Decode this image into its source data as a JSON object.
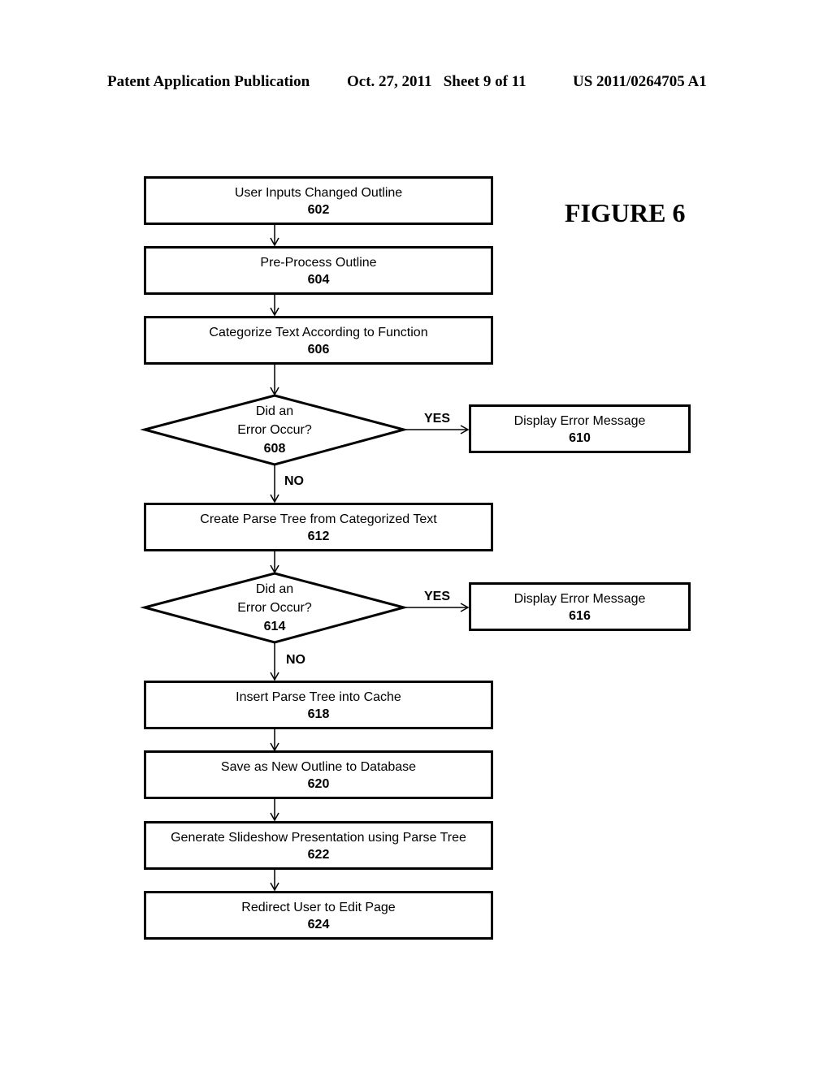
{
  "header": {
    "publication": "Patent Application Publication",
    "date_sheet": "Oct. 27, 2011   Sheet 9 of 11",
    "patent_number": "US 2011/0264705 A1"
  },
  "figure_title": "FIGURE 6",
  "nodes": {
    "n602": {
      "label": "User Inputs Changed Outline",
      "id": "602",
      "shape": "process"
    },
    "n604": {
      "label": "Pre-Process Outline",
      "id": "604",
      "shape": "process"
    },
    "n606": {
      "label": "Categorize Text According to Function",
      "id": "606",
      "shape": "process"
    },
    "n608": {
      "line1": "Did an",
      "line2": "Error Occur?",
      "id": "608",
      "shape": "decision"
    },
    "n610": {
      "label": "Display Error Message",
      "id": "610",
      "shape": "process"
    },
    "n612": {
      "label": "Create Parse Tree from Categorized Text",
      "id": "612",
      "shape": "process"
    },
    "n614": {
      "line1": "Did an",
      "line2": "Error Occur?",
      "id": "614",
      "shape": "decision"
    },
    "n616": {
      "label": "Display Error Message",
      "id": "616",
      "shape": "process"
    },
    "n618": {
      "label": "Insert Parse Tree into Cache",
      "id": "618",
      "shape": "process"
    },
    "n620": {
      "label": "Save as New Outline to Database",
      "id": "620",
      "shape": "process"
    },
    "n622": {
      "label": "Generate Slideshow Presentation using Parse Tree",
      "id": "622",
      "shape": "process"
    },
    "n624": {
      "label": "Redirect User to Edit Page",
      "id": "624",
      "shape": "process"
    }
  },
  "edges": [
    {
      "from": "602",
      "to": "604",
      "label": ""
    },
    {
      "from": "604",
      "to": "606",
      "label": ""
    },
    {
      "from": "606",
      "to": "608",
      "label": ""
    },
    {
      "from": "608",
      "to": "610",
      "label": "YES"
    },
    {
      "from": "608",
      "to": "612",
      "label": "NO"
    },
    {
      "from": "612",
      "to": "614",
      "label": ""
    },
    {
      "from": "614",
      "to": "616",
      "label": "YES"
    },
    {
      "from": "614",
      "to": "618",
      "label": "NO"
    },
    {
      "from": "618",
      "to": "620",
      "label": ""
    },
    {
      "from": "620",
      "to": "622",
      "label": ""
    },
    {
      "from": "622",
      "to": "624",
      "label": ""
    }
  ],
  "edge_labels": {
    "yes": "YES",
    "no": "NO"
  }
}
